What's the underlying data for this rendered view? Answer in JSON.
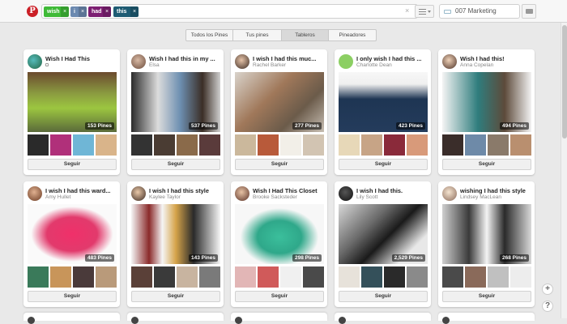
{
  "search": {
    "tags": [
      {
        "label": "wish",
        "color": "#3fba37"
      },
      {
        "label": "i",
        "color": "#6b89b0"
      },
      {
        "label": "had",
        "color": "#7c1f72"
      },
      {
        "label": "this",
        "color": "#1e5b73"
      }
    ],
    "clear_symbol": "×",
    "tag_remove_symbol": "×"
  },
  "board_field": {
    "value": "007 Marketing"
  },
  "filters": {
    "tabs": [
      {
        "label": "Todos los Pines",
        "active": false
      },
      {
        "label": "Tus pines",
        "active": false
      },
      {
        "label": "Tableros",
        "active": true
      },
      {
        "label": "Pineadores",
        "active": false
      }
    ]
  },
  "follow_label": "Seguir",
  "boards": [
    {
      "title": "Wish I Had This",
      "user": "",
      "pins": "153 Pines",
      "private": true
    },
    {
      "title": "Wish I had this in my ...",
      "user": "Elsa",
      "pins": "537 Pines"
    },
    {
      "title": "I wish I had this muc...",
      "user": "Rachel Barker",
      "pins": "277 Pines"
    },
    {
      "title": "I only wish I had this ...",
      "user": "Charlotte Dean",
      "pins": "423 Pines"
    },
    {
      "title": "Wish I had this!",
      "user": "Anna Copelan",
      "pins": "494 Pines"
    },
    {
      "title": "I wish I had this ward...",
      "user": "Amy Hullet",
      "pins": "483 Pines"
    },
    {
      "title": "I wish I had this style",
      "user": "Kaylee Taylor",
      "pins": "143 Pines"
    },
    {
      "title": "Wish I Had This Closet",
      "user": "Brooke Sacksteder",
      "pins": "298 Pines"
    },
    {
      "title": "I wish I had this.",
      "user": "Lily Scott",
      "pins": "2,529 Pines"
    },
    {
      "title": "wishing I had this style",
      "user": "Lindsey MacLean",
      "pins": "268 Pines"
    }
  ],
  "fab": {
    "add": "+",
    "help": "?"
  }
}
